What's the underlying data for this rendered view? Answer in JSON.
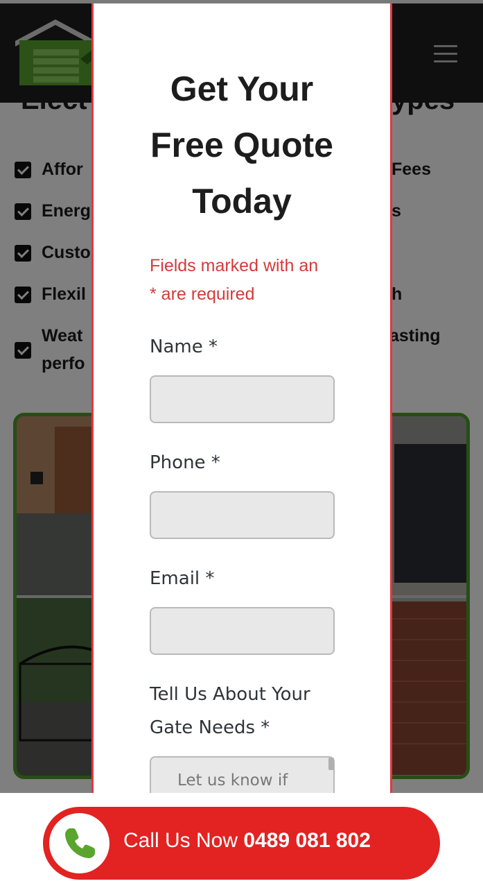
{
  "background_page": {
    "section_heading_left": "Elect",
    "section_heading_right": "ypes",
    "features": [
      {
        "left": "Affor",
        "right": "Fees"
      },
      {
        "left": "Energ",
        "right": "s"
      },
      {
        "left": "Custo",
        "right": ""
      },
      {
        "left": "Flexil",
        "right": "h"
      },
      {
        "left": "Weat",
        "left2": "perfo",
        "right": "lasting"
      }
    ]
  },
  "modal": {
    "title_line1": "Get Your",
    "title_line2": "Free Quote",
    "title_line3": "Today",
    "required_note_line1": "Fields marked with an",
    "required_note_line2": "* are required",
    "fields": {
      "name_label": "Name *",
      "phone_label": "Phone *",
      "email_label": "Email *",
      "needs_label_line1": "Tell Us About Your",
      "needs_label_line2": "Gate Needs *",
      "needs_placeholder": "Let us know if"
    }
  },
  "callbar": {
    "label": "Call Us Now ",
    "number": "0489 081 802"
  },
  "colors": {
    "accent_red": "#e32222",
    "brand_green": "#4f9a2a",
    "header_dark": "#1f1f1f"
  },
  "icons": [
    "garage-logo-icon",
    "hamburger-menu-icon",
    "checkbox-icon",
    "phone-icon"
  ]
}
